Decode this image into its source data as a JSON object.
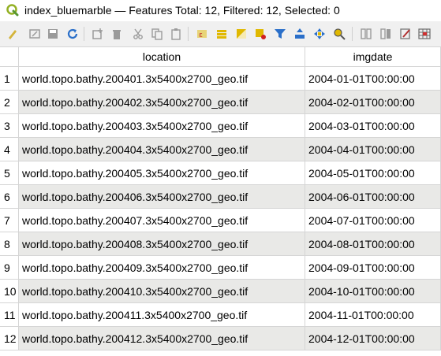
{
  "window": {
    "title": "index_bluemarble — Features Total: 12, Filtered: 12, Selected: 0"
  },
  "toolbar": {
    "buttons": [
      {
        "name": "toggle-editing-icon",
        "color": "#d4b43a"
      },
      {
        "name": "multi-edit-icon",
        "color": "#9a9a9a"
      },
      {
        "name": "save-edits-icon",
        "color": "#9a9a9a"
      },
      {
        "name": "reload-icon",
        "color": "#2a6fc9"
      },
      {
        "name": "add-feature-icon",
        "color": "#9a9a9a"
      },
      {
        "name": "delete-feature-icon",
        "color": "#9a9a9a"
      },
      {
        "name": "cut-icon",
        "color": "#9a9a9a"
      },
      {
        "name": "copy-icon",
        "color": "#9a9a9a"
      },
      {
        "name": "paste-icon",
        "color": "#9a9a9a"
      },
      {
        "name": "select-by-expression-icon",
        "color": "#e0b800"
      },
      {
        "name": "select-all-icon",
        "color": "#e0b800"
      },
      {
        "name": "invert-selection-icon",
        "color": "#e0b800"
      },
      {
        "name": "deselect-all-icon",
        "color": "#e0b800"
      },
      {
        "name": "filter-icon",
        "color": "#2a6fc9"
      },
      {
        "name": "move-selection-to-top-icon",
        "color": "#2a6fc9"
      },
      {
        "name": "pan-to-selected-icon",
        "color": "#2a6fc9"
      },
      {
        "name": "zoom-to-selected-icon",
        "color": "#e0b800"
      },
      {
        "name": "new-field-icon",
        "color": "#9a9a9a"
      },
      {
        "name": "delete-field-icon",
        "color": "#9a9a9a"
      },
      {
        "name": "field-calculator-icon",
        "color": "#b03030"
      },
      {
        "name": "conditional-formatting-icon",
        "color": "#6a6a6a"
      }
    ]
  },
  "table": {
    "columns": [
      "location",
      "imgdate"
    ],
    "rows": [
      {
        "num": "1",
        "location": "world.topo.bathy.200401.3x5400x2700_geo.tif",
        "imgdate": "2004-01-01T00:00:00"
      },
      {
        "num": "2",
        "location": "world.topo.bathy.200402.3x5400x2700_geo.tif",
        "imgdate": "2004-02-01T00:00:00"
      },
      {
        "num": "3",
        "location": "world.topo.bathy.200403.3x5400x2700_geo.tif",
        "imgdate": "2004-03-01T00:00:00"
      },
      {
        "num": "4",
        "location": "world.topo.bathy.200404.3x5400x2700_geo.tif",
        "imgdate": "2004-04-01T00:00:00"
      },
      {
        "num": "5",
        "location": "world.topo.bathy.200405.3x5400x2700_geo.tif",
        "imgdate": "2004-05-01T00:00:00"
      },
      {
        "num": "6",
        "location": "world.topo.bathy.200406.3x5400x2700_geo.tif",
        "imgdate": "2004-06-01T00:00:00"
      },
      {
        "num": "7",
        "location": "world.topo.bathy.200407.3x5400x2700_geo.tif",
        "imgdate": "2004-07-01T00:00:00"
      },
      {
        "num": "8",
        "location": "world.topo.bathy.200408.3x5400x2700_geo.tif",
        "imgdate": "2004-08-01T00:00:00"
      },
      {
        "num": "9",
        "location": "world.topo.bathy.200409.3x5400x2700_geo.tif",
        "imgdate": "2004-09-01T00:00:00"
      },
      {
        "num": "10",
        "location": "world.topo.bathy.200410.3x5400x2700_geo.tif",
        "imgdate": "2004-10-01T00:00:00"
      },
      {
        "num": "11",
        "location": "world.topo.bathy.200411.3x5400x2700_geo.tif",
        "imgdate": "2004-11-01T00:00:00"
      },
      {
        "num": "12",
        "location": "world.topo.bathy.200412.3x5400x2700_geo.tif",
        "imgdate": "2004-12-01T00:00:00"
      }
    ]
  }
}
